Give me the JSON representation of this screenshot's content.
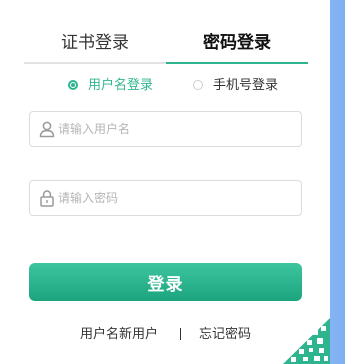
{
  "tabs": {
    "certificate_login": "证书登录",
    "password_login": "密码登录"
  },
  "login_mode": {
    "username_option": "用户名登录",
    "phone_option": "手机号登录",
    "selected": "用户名登录"
  },
  "form": {
    "username_placeholder": "请输入用户名",
    "password_placeholder": "请输入密码",
    "username_value": "",
    "password_value": ""
  },
  "actions": {
    "login_button": "登录",
    "register_link": "用户名新用户",
    "forgot_link": "忘记密码"
  },
  "icons": {
    "username": "user-icon",
    "password": "lock-icon",
    "corner": "qr-code-icon"
  },
  "colors": {
    "accent": "#2eb58f",
    "button": "#1ba47d",
    "background_right": "#7fb0f3"
  }
}
